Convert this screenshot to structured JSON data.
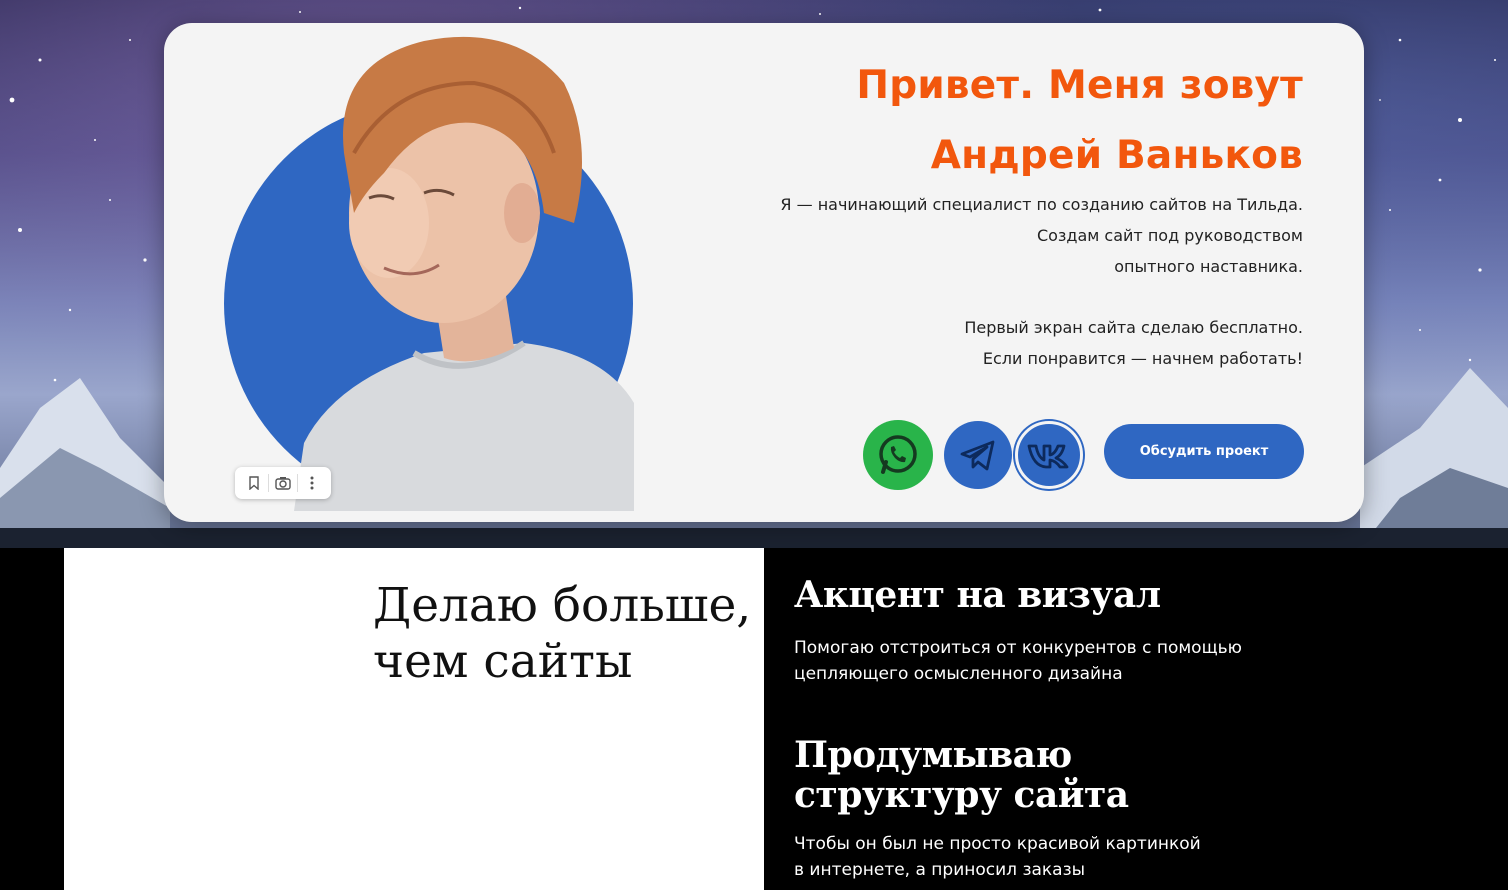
{
  "hero": {
    "title_line1": "Привет. Меня зовут",
    "title_line2": "Андрей Ваньков",
    "desc_line1": "Я — начинающий специалист по созданию сайтов на Тильда.",
    "desc_line2": "Создам сайт под руководством",
    "desc_line3": "опытного наставника.",
    "desc_line4": "Первый экран сайта сделаю бесплатно.",
    "desc_line5": "Если понравится — начнем работать!",
    "cta_label": "Обсудить проект",
    "social": [
      {
        "name": "whatsapp-icon",
        "color": "#29b44a"
      },
      {
        "name": "telegram-icon",
        "color": "#2f67c2"
      },
      {
        "name": "vk-icon",
        "color": "#2f67c2"
      }
    ],
    "colors": {
      "accent": "#f2570d",
      "brand_blue": "#2f67c2",
      "card_bg": "#f4f4f4"
    }
  },
  "image_toolbar": {
    "icons": [
      "bookmark-icon",
      "camera-search-icon",
      "more-vertical-icon"
    ]
  },
  "section2": {
    "title_line1": "Делаю больше,",
    "title_line2": "чем сайты",
    "features": [
      {
        "title": "Акцент на визуал",
        "text_line1": "Помогаю отстроиться от конкурентов с помощью",
        "text_line2": "цепляющего осмысленного дизайна"
      },
      {
        "title_line1": "Продумываю",
        "title_line2": "структуру сайта",
        "text_line1": "Чтобы он был не просто красивой картинкой",
        "text_line2": "в интернете, а приносил заказы"
      }
    ]
  }
}
